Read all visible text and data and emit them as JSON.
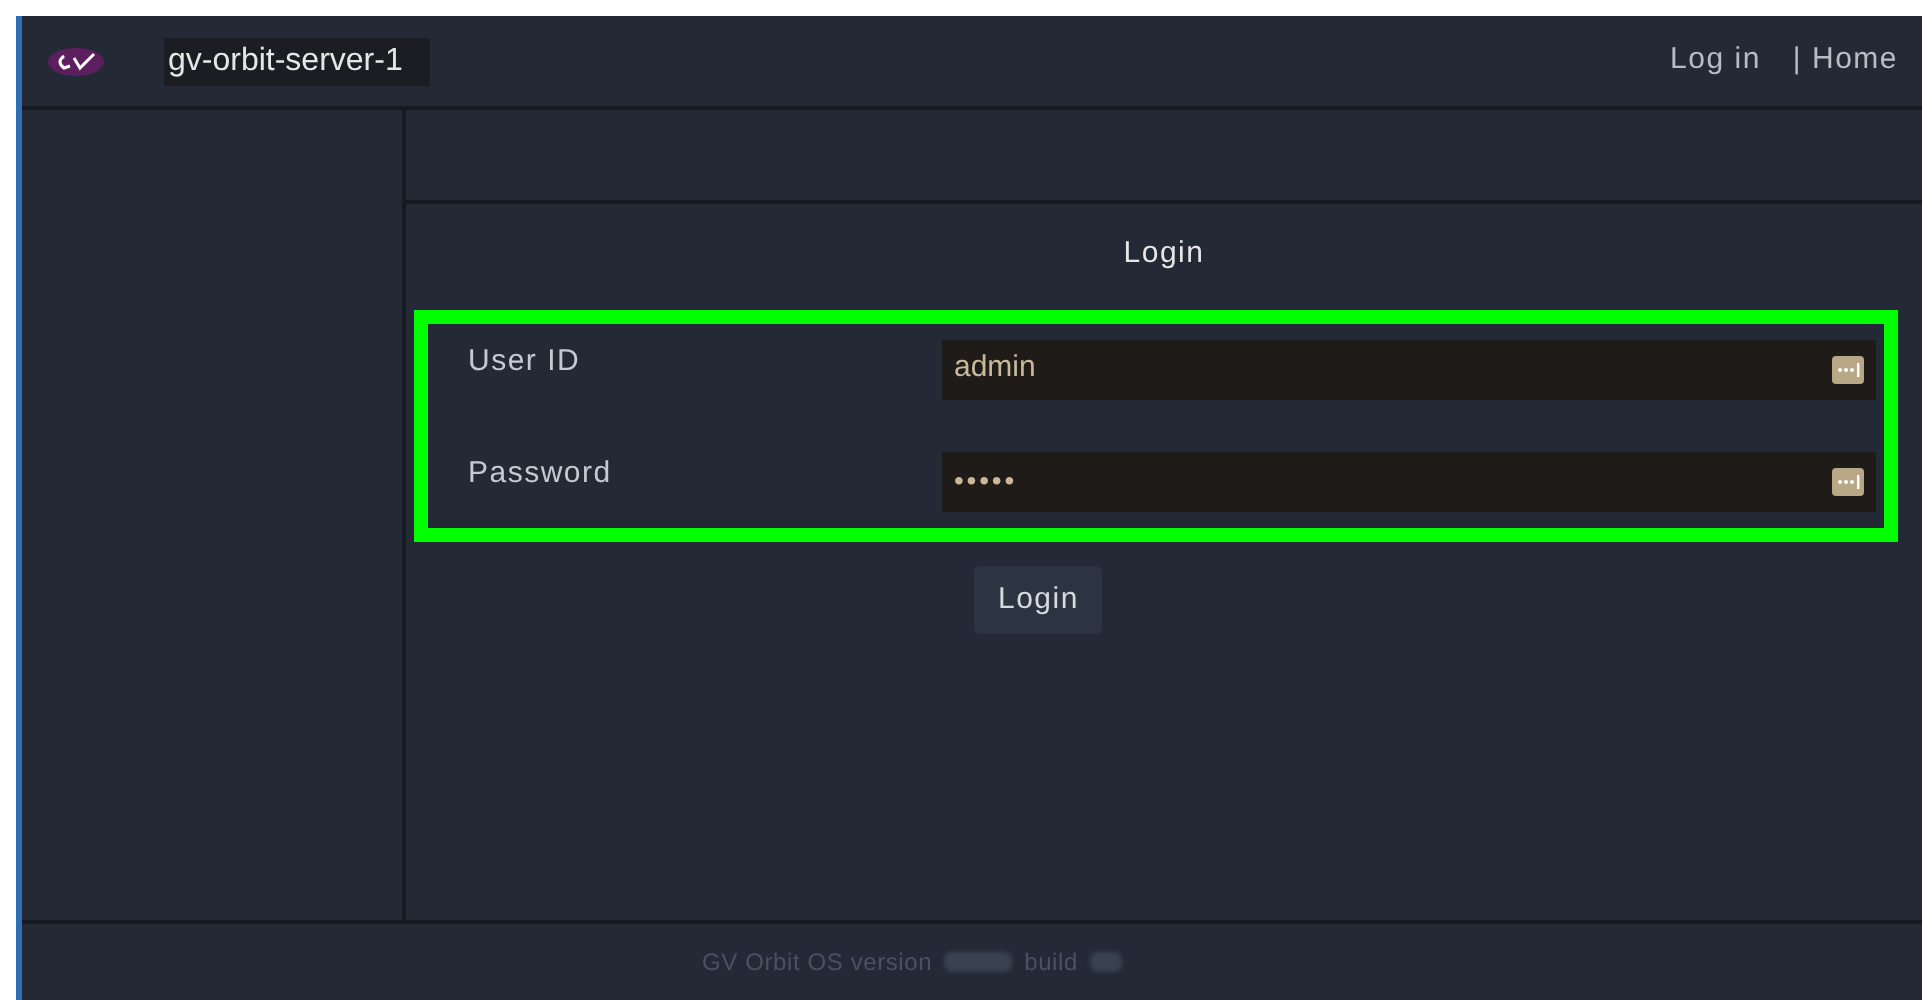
{
  "header": {
    "server_name": "gv-orbit-server-1",
    "links": [
      "Log in",
      "| Home"
    ]
  },
  "login": {
    "title": "Login",
    "fields": [
      {
        "label": "User ID",
        "value": "admin",
        "kind": "text"
      },
      {
        "label": "Password",
        "value": "•••••",
        "kind": "password"
      }
    ],
    "button": "Login"
  },
  "footer": {
    "version_label": "GV Orbit OS version",
    "build_label": "build"
  }
}
